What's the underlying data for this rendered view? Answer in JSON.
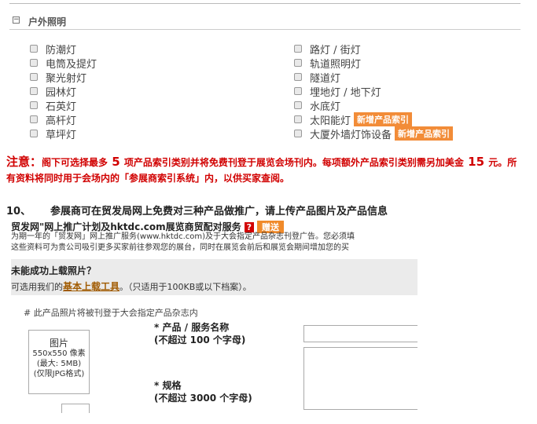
{
  "section": {
    "title": "户外照明",
    "toggle": "−"
  },
  "left_items": [
    {
      "label": "防潮灯"
    },
    {
      "label": "电筒及提灯"
    },
    {
      "label": "聚光射灯"
    },
    {
      "label": "园林灯"
    },
    {
      "label": "石英灯"
    },
    {
      "label": "高杆灯"
    },
    {
      "label": "草坪灯"
    }
  ],
  "right_items": [
    {
      "label": "路灯 / 街灯"
    },
    {
      "label": "轨道照明灯"
    },
    {
      "label": "隧道灯"
    },
    {
      "label": "埋地灯 / 地下灯"
    },
    {
      "label": "水底灯"
    },
    {
      "label": "太阳能灯",
      "badge": "新增产品索引"
    },
    {
      "label": "大厦外墙灯饰设备",
      "badge": "新增产品索引"
    }
  ],
  "notice": {
    "lead": "注意：",
    "part1": "阁下可选择最多",
    "count": " 5 ",
    "part2": "项产品索引类别并将免费刊登于展览会场刊内。每项额外产品索引类别需另加美金",
    "price": " 15 ",
    "part3": "元。所有资料将同时用于会场内的「参展商索引系统」内，以供买家查阅。"
  },
  "step": {
    "number": "10、",
    "text": "参展商可在贸发局网上免费对三种产品做推广，请上传产品图片及产品信息"
  },
  "embed": {
    "title": "贸发网\"网上推广计划及hktdc.com展览商贸配对服务",
    "q_icon": "?",
    "gift": "赠送",
    "line1": "为期一年的「贸发网」网上推广服务(www.hktdc.com)及于大会指定产品杂志刊登广告。您必须填",
    "line2": "这些资料可为贵公司吸引更多买家前往参观您的展台，同时在展览会前后和展览会期间增加您的买",
    "band_title": "未能成功上载照片？",
    "band_sub_pre": "可选用我们的",
    "band_link": "基本上载工具",
    "band_sub_post": "。（只适用于100KB或以下档案）。",
    "note": "# 此产品照片将被刊登于大会指定产品杂志内",
    "photo_title": "图片",
    "photo_size": "550x550 像素",
    "photo_max": "(最大: 5MB)",
    "photo_fmt": "(仅限JPG格式)",
    "name_label": "* 产品 / 服务名称",
    "name_limit": "(不超过 100 个字母)",
    "spec_label": "* 规格",
    "spec_limit": "(不超过 3000 个字母)"
  }
}
